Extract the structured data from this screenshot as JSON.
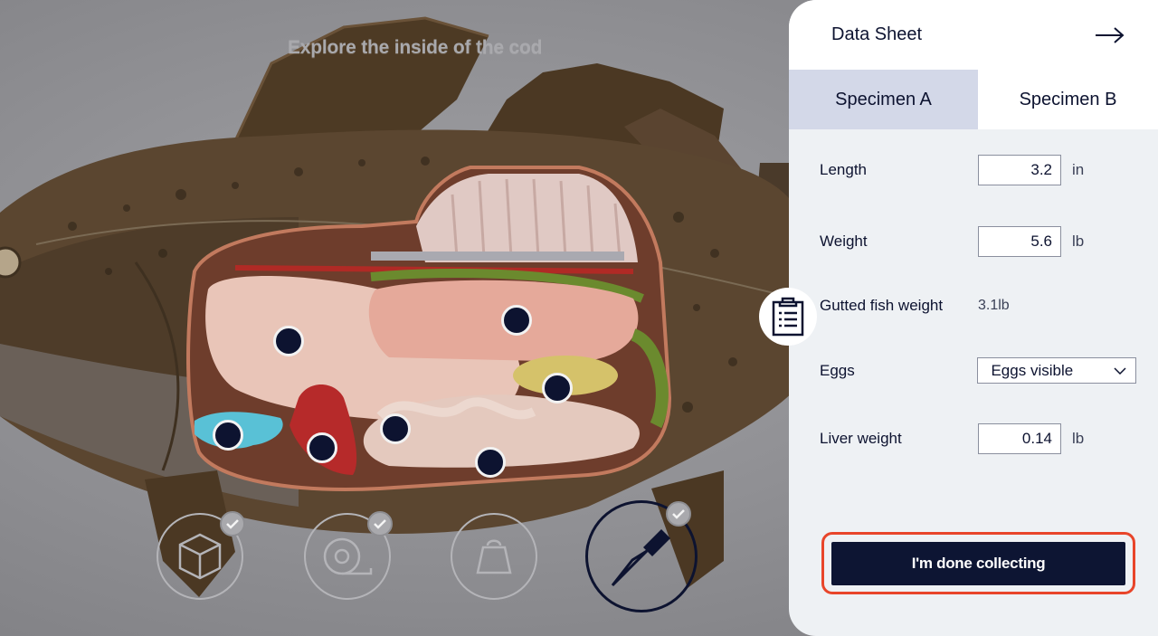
{
  "scene": {
    "title": "Explore the inside of the cod",
    "hotspots": [
      "stomach-hotspot",
      "liver-hotspot",
      "gonad-hotspot",
      "gill-hotspot",
      "heart-hotspot",
      "pyloric-hotspot",
      "intestine-hotspot",
      "swimbladder-hotspot"
    ],
    "tools": [
      {
        "name": "3d-box-tool",
        "icon": "cube-icon",
        "completed": true,
        "active": false
      },
      {
        "name": "measure-tape-tool",
        "icon": "tape-measure-icon",
        "completed": true,
        "active": false
      },
      {
        "name": "scale-weight-tool",
        "icon": "weight-icon",
        "completed": false,
        "active": false
      },
      {
        "name": "scalpel-tool",
        "icon": "scalpel-icon",
        "completed": true,
        "active": true
      }
    ]
  },
  "panel": {
    "title": "Data Sheet",
    "close_icon": "arrow-right-icon",
    "tabs": [
      {
        "label": "Specimen A",
        "selected": true
      },
      {
        "label": "Specimen B",
        "selected": false
      }
    ],
    "fields": {
      "length": {
        "label": "Length",
        "value": "3.2",
        "unit": "in"
      },
      "weight": {
        "label": "Weight",
        "value": "5.6",
        "unit": "lb"
      },
      "gutted": {
        "label": "Gutted fish weight",
        "value": "3.1lb"
      },
      "eggs": {
        "label": "Eggs",
        "value": "Eggs visible"
      },
      "liver": {
        "label": "Liver weight",
        "value": "0.14",
        "unit": "lb"
      }
    },
    "clipboard_icon": "clipboard-icon",
    "done_button": "I'm done collecting"
  },
  "colors": {
    "navy": "#0d1330",
    "tab_selected": "#d3d8e8",
    "highlight": "#e8452a",
    "panel_bg": "#eef1f4"
  }
}
